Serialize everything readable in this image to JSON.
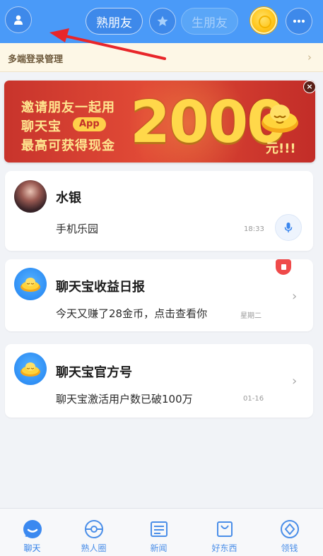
{
  "header": {
    "profile_icon": "person-icon",
    "tabs": [
      {
        "label": "熟朋友",
        "active": true
      },
      {
        "label": "生朋友",
        "active": false
      }
    ],
    "star_icon": "star-icon",
    "coin_icon": "gold-coin-icon",
    "more_icon": "more-dots-icon"
  },
  "notice": {
    "text": "多端登录管理"
  },
  "banner": {
    "line1": "邀请朋友一起用",
    "line2": "聊天宝",
    "app_tag": "App",
    "line3": "最高可获得现金",
    "amount": "2000",
    "suffix": "元!!!"
  },
  "chats": [
    {
      "name": "水银",
      "message": "手机乐园",
      "time": "18:33",
      "action_icon": "microphone-icon"
    },
    {
      "name": "聊天宝收益日报",
      "message": "今天又赚了28金币，点击查看你",
      "time": "星期二",
      "badge_icon": "red-packet-icon"
    },
    {
      "name": "聊天宝官方号",
      "message": "聊天宝激活用户数已破100万",
      "time": "01-16"
    }
  ],
  "bottom_nav": [
    {
      "label": "聊天",
      "icon": "chat-bubble-icon"
    },
    {
      "label": "熟人圈",
      "icon": "circle-icon"
    },
    {
      "label": "新闻",
      "icon": "news-icon"
    },
    {
      "label": "好东西",
      "icon": "shopping-bag-icon"
    },
    {
      "label": "领钱",
      "icon": "coin-diamond-icon"
    }
  ],
  "colors": {
    "header_blue": "#4a9af8",
    "accent_blue": "#2f7fe8",
    "banner_red": "#c8342c",
    "gold": "#ffd84a"
  }
}
